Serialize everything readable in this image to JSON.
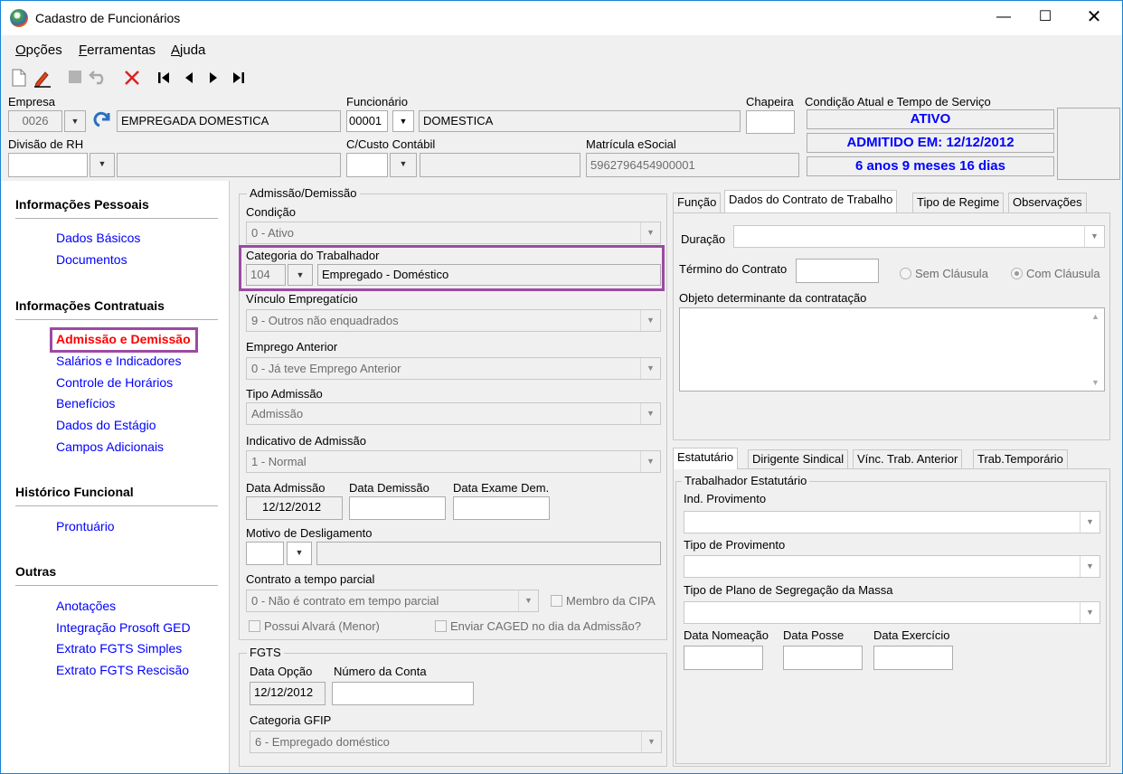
{
  "window": {
    "title": "Cadastro de Funcionários"
  },
  "menu": {
    "items": [
      {
        "prefix": "",
        "mnemonic": "O",
        "rest": "pções"
      },
      {
        "prefix": "",
        "mnemonic": "F",
        "rest": "erramentas"
      },
      {
        "prefix": "",
        "mnemonic": "A",
        "rest": "juda"
      }
    ]
  },
  "header": {
    "empresa_label": "Empresa",
    "empresa_code": "0026",
    "empresa_name": "EMPREGADA DOMESTICA",
    "funcionario_label": "Funcionário",
    "funcionario_code": "00001",
    "funcionario_name": "DOMESTICA",
    "chapeira_label": "Chapeira",
    "chapeira_value": "",
    "condicao_label": "Condição Atual e Tempo de Serviço",
    "status": "ATIVO",
    "admitido": "ADMITIDO EM: 12/12/2012",
    "tempo": "6 anos 9 meses 16 dias",
    "divisao_label": "Divisão de RH",
    "ccusto_label": "C/Custo Contábil",
    "matricula_label": "Matrícula eSocial",
    "matricula_value": "5962796454900001"
  },
  "sidebar": {
    "sections": [
      {
        "title": "Informações Pessoais",
        "links": [
          "Dados Básicos",
          "Documentos"
        ]
      },
      {
        "title": "Informações Contratuais",
        "links": [
          "Admissão e Demissão",
          "Salários e Indicadores",
          "Controle de Horários",
          "Benefícios",
          "Dados do Estágio",
          "Campos Adicionais"
        ]
      },
      {
        "title": "Histórico Funcional",
        "links": [
          "Prontuário"
        ]
      },
      {
        "title": "Outras",
        "links": [
          "Anotações",
          "Integração Prosoft GED",
          "Extrato FGTS Simples",
          "Extrato FGTS Rescisão"
        ]
      }
    ],
    "active_link": "Admissão e Demissão"
  },
  "admissao": {
    "group_title": "Admissão/Demissão",
    "condicao_label": "Condição",
    "condicao_value": "0 - Ativo",
    "categoria_label": "Categoria do Trabalhador",
    "categoria_code": "104",
    "categoria_name": "Empregado - Doméstico",
    "vinculo_label": "Vínculo Empregatício",
    "vinculo_value": "9 - Outros não enquadrados",
    "emprego_anterior_label": "Emprego Anterior",
    "emprego_anterior_value": "0 - Já teve Emprego Anterior",
    "tipo_admissao_label": "Tipo Admissão",
    "tipo_admissao_value": "Admissão",
    "indicativo_label": "Indicativo de Admissão",
    "indicativo_value": "1 - Normal",
    "data_admissao_label": "Data Admissão",
    "data_admissao_value": "12/12/2012",
    "data_demissao_label": "Data Demissão",
    "data_exame_label": "Data Exame Dem.",
    "motivo_label": "Motivo de Desligamento",
    "contrato_parcial_label": "Contrato a tempo parcial",
    "contrato_parcial_value": "0 - Não é contrato em tempo parcial",
    "membro_cipa": "Membro da CIPA",
    "possui_alvara": "Possui Alvará (Menor)",
    "enviar_caged": "Enviar CAGED no dia da Admissão?"
  },
  "fgts": {
    "group_title": "FGTS",
    "data_opcao_label": "Data Opção",
    "data_opcao_value": "12/12/2012",
    "numero_conta_label": "Número da Conta",
    "categoria_gfip_label": "Categoria GFIP",
    "categoria_gfip_value": "6 - Empregado doméstico"
  },
  "contrato_tabs": {
    "tabs": [
      "Função",
      "Dados do Contrato de Trabalho",
      "Tipo de Regime",
      "Observações"
    ],
    "active": "Dados do Contrato de Trabalho",
    "duracao_label": "Duração",
    "termino_label": "Término do Contrato",
    "sem_clausula": "Sem Cláusula",
    "com_clausula": "Com Cláusula",
    "objeto_label": "Objeto determinante da contratação"
  },
  "estatutario_tabs": {
    "tabs": [
      "Estatutário",
      "Dirigente Sindical",
      "Vínc. Trab. Anterior",
      "Trab.Temporário"
    ],
    "active": "Estatutário",
    "group_title": "Trabalhador Estatutário",
    "ind_provimento_label": "Ind. Provimento",
    "tipo_provimento_label": "Tipo de Provimento",
    "tipo_plano_label": "Tipo de Plano de Segregação da Massa",
    "data_nomeacao_label": "Data Nomeação",
    "data_posse_label": "Data Posse",
    "data_exercicio_label": "Data Exercício"
  },
  "colors": {
    "accent_link": "#0000ff",
    "active_link": "#ff0000",
    "highlight": "#9b4aa3",
    "status_text": "#0000ff"
  }
}
